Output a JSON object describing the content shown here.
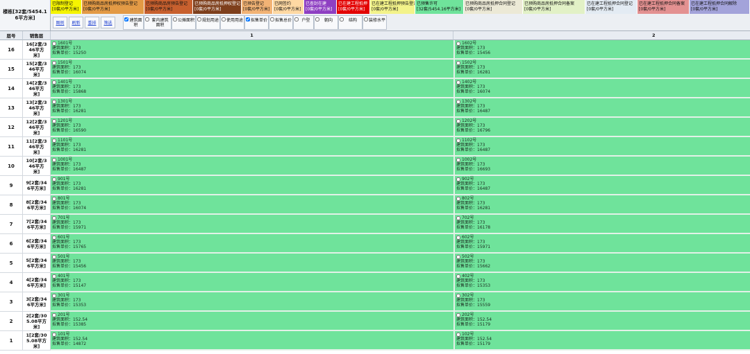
{
  "building": {
    "summary": "楼栋[32套/5454.16平方米]"
  },
  "legend": [
    {
      "label": "已限制登记",
      "stat": "[0套/0平方米]",
      "color": "#f5f400"
    },
    {
      "label": "已预购商品房抵押权预告登记",
      "stat": "[0套/0平方米]",
      "color": "#e39a45"
    },
    {
      "label": "已预购商品房预告登记",
      "stat": "[0套/0平方米]",
      "color": "#c8602e"
    },
    {
      "label": "已预购商品房抵押权登记",
      "stat": "[0套/0平方米]",
      "color": "#7e3f1c"
    },
    {
      "label": "已预告登记",
      "stat": "[0套/0平方米]",
      "color": "#f2b375"
    },
    {
      "label": "已网签约",
      "stat": "[0套/0平方米]",
      "color": "#ffd9a3"
    },
    {
      "label": "已查封在建",
      "stat": "[0套/0平方米]",
      "color": "#8e3fc2"
    },
    {
      "label": "已在建工程抵押",
      "stat": "[0套/0平方米]",
      "color": "#e30000"
    },
    {
      "label": "已在建工程抵押预告登记",
      "stat": "[0套/0平方米]",
      "color": "#f3f38a"
    },
    {
      "label": "已预售许可",
      "stat": "[32套/5454.16平方米]",
      "color": "#6fe39b"
    },
    {
      "label": "已预购商品房抵押合同登记",
      "stat": "[0套/0平方米]",
      "color": "#ece9d6"
    },
    {
      "label": "已预购商品房抵押合同备案",
      "stat": "[0套/0平方米]",
      "color": "#e2f1c6"
    },
    {
      "label": "已在建工程抵押合同登记",
      "stat": "[0套/0平方米]",
      "color": "#e3ebf3"
    },
    {
      "label": "已在建工程抵押合同备案",
      "stat": "[0套/0平方米]",
      "color": "#e39191"
    },
    {
      "label": "已在建工程抵押合同解除",
      "stat": "[0套/0平方米]",
      "color": "#a3a3da"
    }
  ],
  "toolbar": {
    "links": [
      "图例",
      "刷新",
      "重排",
      "筛选"
    ],
    "options": [
      {
        "label": "建筑面积",
        "checked": true
      },
      {
        "label": "套内建筑面积",
        "checked": false
      },
      {
        "label": "公摊面积",
        "checked": false
      },
      {
        "label": "规划用途",
        "checked": false
      },
      {
        "label": "使用用途",
        "checked": false
      },
      {
        "label": "拟售单价",
        "checked": true
      },
      {
        "label": "拟售总价",
        "checked": false
      },
      {
        "label": "户型",
        "checked": false
      },
      {
        "label": "朝向",
        "checked": false
      },
      {
        "label": "结构",
        "checked": false
      },
      {
        "label": "装修水平",
        "checked": false
      }
    ]
  },
  "table": {
    "headers": {
      "floor": "层号",
      "sales_floor": "销售层",
      "columns": [
        "1",
        "2"
      ]
    },
    "unit_labels": {
      "area": "建筑面积：",
      "price": "拟售单价："
    },
    "rows": [
      {
        "floor": "16",
        "sales_floor": "16[2套/346平方米]",
        "units": [
          {
            "number": "1601号",
            "area": "173",
            "price": "15250"
          },
          {
            "number": "1602号",
            "area": "173",
            "price": "15456"
          }
        ]
      },
      {
        "floor": "15",
        "sales_floor": "15[2套/346平方米]",
        "units": [
          {
            "number": "1501号",
            "area": "173",
            "price": "16074"
          },
          {
            "number": "1502号",
            "area": "173",
            "price": "16281"
          }
        ]
      },
      {
        "floor": "14",
        "sales_floor": "14[2套/346平方米]",
        "units": [
          {
            "number": "1401号",
            "area": "173",
            "price": "15868"
          },
          {
            "number": "1402号",
            "area": "173",
            "price": "16074"
          }
        ]
      },
      {
        "floor": "13",
        "sales_floor": "13[2套/346平方米]",
        "units": [
          {
            "number": "1301号",
            "area": "173",
            "price": "16281"
          },
          {
            "number": "1302号",
            "area": "173",
            "price": "16487"
          }
        ]
      },
      {
        "floor": "12",
        "sales_floor": "12[2套/346平方米]",
        "units": [
          {
            "number": "1201号",
            "area": "173",
            "price": "16590"
          },
          {
            "number": "1202号",
            "area": "173",
            "price": "16796"
          }
        ]
      },
      {
        "floor": "11",
        "sales_floor": "11[2套/346平方米]",
        "units": [
          {
            "number": "1101号",
            "area": "173",
            "price": "16281"
          },
          {
            "number": "1102号",
            "area": "173",
            "price": "16487"
          }
        ]
      },
      {
        "floor": "10",
        "sales_floor": "10[2套/346平方米]",
        "units": [
          {
            "number": "1001号",
            "area": "173",
            "price": "16487"
          },
          {
            "number": "1002号",
            "area": "173",
            "price": "16693"
          }
        ]
      },
      {
        "floor": "9",
        "sales_floor": "9[2套/346平方米]",
        "units": [
          {
            "number": "901号",
            "area": "173",
            "price": "16281"
          },
          {
            "number": "902号",
            "area": "173",
            "price": "16487"
          }
        ]
      },
      {
        "floor": "8",
        "sales_floor": "8[2套/346平方米]",
        "units": [
          {
            "number": "801号",
            "area": "173",
            "price": "16074"
          },
          {
            "number": "802号",
            "area": "173",
            "price": "16281"
          }
        ]
      },
      {
        "floor": "7",
        "sales_floor": "7[2套/346平方米]",
        "units": [
          {
            "number": "701号",
            "area": "173",
            "price": "15971"
          },
          {
            "number": "702号",
            "area": "173",
            "price": "16178"
          }
        ]
      },
      {
        "floor": "6",
        "sales_floor": "6[2套/346平方米]",
        "units": [
          {
            "number": "601号",
            "area": "173",
            "price": "15765"
          },
          {
            "number": "602号",
            "area": "173",
            "price": "15971"
          }
        ]
      },
      {
        "floor": "5",
        "sales_floor": "5[2套/346平方米]",
        "units": [
          {
            "number": "501号",
            "area": "173",
            "price": "15456"
          },
          {
            "number": "502号",
            "area": "173",
            "price": "15662"
          }
        ]
      },
      {
        "floor": "4",
        "sales_floor": "4[2套/346平方米]",
        "units": [
          {
            "number": "401号",
            "area": "173",
            "price": "15147"
          },
          {
            "number": "402号",
            "area": "173",
            "price": "15353"
          }
        ]
      },
      {
        "floor": "3",
        "sales_floor": "3[2套/346平方米]",
        "units": [
          {
            "number": "301号",
            "area": "173",
            "price": "15353"
          },
          {
            "number": "302号",
            "area": "173",
            "price": "15559"
          }
        ]
      },
      {
        "floor": "2",
        "sales_floor": "2[2套/305.08平方米]",
        "units": [
          {
            "number": "201号",
            "area": "152.54",
            "price": "15385"
          },
          {
            "number": "202号",
            "area": "152.54",
            "price": "15179"
          }
        ]
      },
      {
        "floor": "1",
        "sales_floor": "1[2套/305.08平方米]",
        "units": [
          {
            "number": "101号",
            "area": "152.54",
            "price": "14872"
          },
          {
            "number": "102号",
            "area": "152.54",
            "price": "15179"
          }
        ]
      }
    ]
  }
}
